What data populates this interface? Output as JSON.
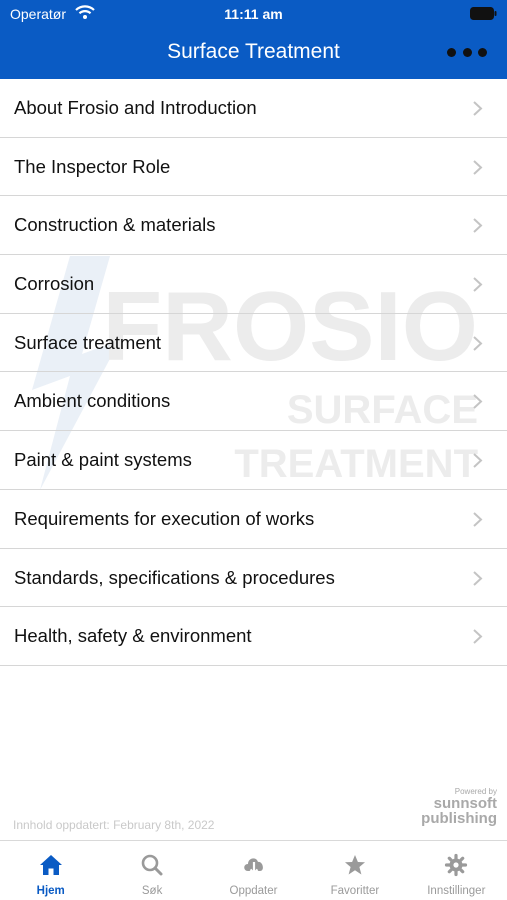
{
  "status": {
    "carrier": "Operatør",
    "time": "11:11 am"
  },
  "header": {
    "title": "Surface Treatment"
  },
  "menu": {
    "items": [
      {
        "label": "About Frosio and Introduction"
      },
      {
        "label": "The Inspector Role"
      },
      {
        "label": "Construction & materials"
      },
      {
        "label": "Corrosion"
      },
      {
        "label": "Surface treatment"
      },
      {
        "label": "Ambient conditions"
      },
      {
        "label": "Paint & paint systems"
      },
      {
        "label": "Requirements for execution of works"
      },
      {
        "label": "Standards, specifications & procedures"
      },
      {
        "label": "Health, safety & environment"
      }
    ]
  },
  "watermark": {
    "line1": "FROSIO",
    "line2": "SURFACE",
    "line3": "TREATMENT"
  },
  "footer": {
    "updated": "Innhold oppdatert: February 8th, 2022",
    "powered_by": "Powered by",
    "brand_line1": "sunnsoft",
    "brand_line2": "publishing"
  },
  "tabs": [
    {
      "label": "Hjem",
      "icon": "home-icon"
    },
    {
      "label": "Søk",
      "icon": "search-icon"
    },
    {
      "label": "Oppdater",
      "icon": "cloud-download-icon"
    },
    {
      "label": "Favoritter",
      "icon": "star-icon"
    },
    {
      "label": "Innstillinger",
      "icon": "gear-icon"
    }
  ],
  "colors": {
    "brand": "#0a5bc4",
    "active_tab": "#0a5bc4",
    "inactive_tab": "#9a9a9a"
  }
}
